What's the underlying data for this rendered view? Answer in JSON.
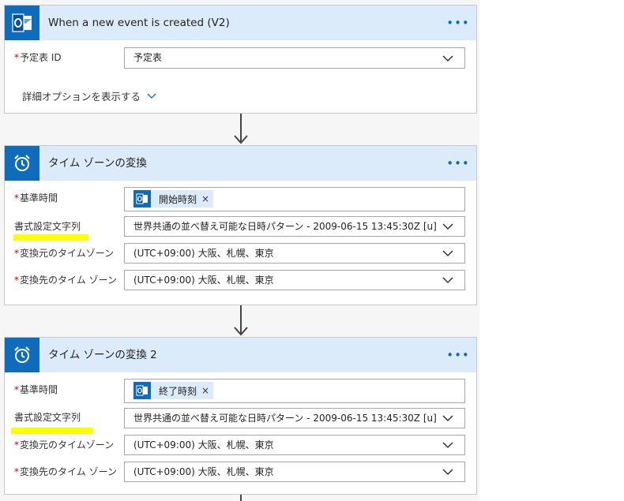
{
  "trigger": {
    "title": "When a new event is created (V2)",
    "icon": "outlook-icon",
    "more_label": "•••",
    "fields": [
      {
        "required": true,
        "label": "予定表 ID",
        "value": "予定表"
      }
    ],
    "advanced_label": "詳細オプションを表示する"
  },
  "actions": [
    {
      "title": "タイム ゾーンの変換",
      "icon": "alarm-clock-icon",
      "more_label": "•••",
      "base_time": {
        "required": true,
        "label": "基準時間",
        "token": "開始時刻",
        "token_icon": "outlook-icon",
        "remove": "×"
      },
      "format": {
        "required": false,
        "label": "書式設定文字列",
        "value": "世界共通の並べ替え可能な日時パターン - 2009-06-15 13:45:30Z [u]"
      },
      "source_tz": {
        "required": true,
        "label": "変換元のタイムゾーン",
        "value": "(UTC+09:00) 大阪、札幌、東京"
      },
      "dest_tz": {
        "required": true,
        "label": "変換先のタイム ゾーン",
        "value": "(UTC+09:00) 大阪、札幌、東京"
      }
    },
    {
      "title": "タイム ゾーンの変換 2",
      "icon": "alarm-clock-icon",
      "more_label": "•••",
      "base_time": {
        "required": true,
        "label": "基準時間",
        "token": "終了時刻",
        "token_icon": "outlook-icon",
        "remove": "×"
      },
      "format": {
        "required": false,
        "label": "書式設定文字列",
        "value": "世界共通の並べ替え可能な日時パターン - 2009-06-15 13:45:30Z [u]"
      },
      "source_tz": {
        "required": true,
        "label": "変換元のタイムゾーン",
        "value": "(UTC+09:00) 大阪、札幌、東京"
      },
      "dest_tz": {
        "required": true,
        "label": "変換先のタイム ゾーン",
        "value": "(UTC+09:00) 大阪、札幌、東京"
      }
    }
  ],
  "colors": {
    "accent": "#0f6cbd",
    "header_bg": "#dcebfa",
    "required": "#cc0000",
    "highlight": "#ffff00"
  }
}
